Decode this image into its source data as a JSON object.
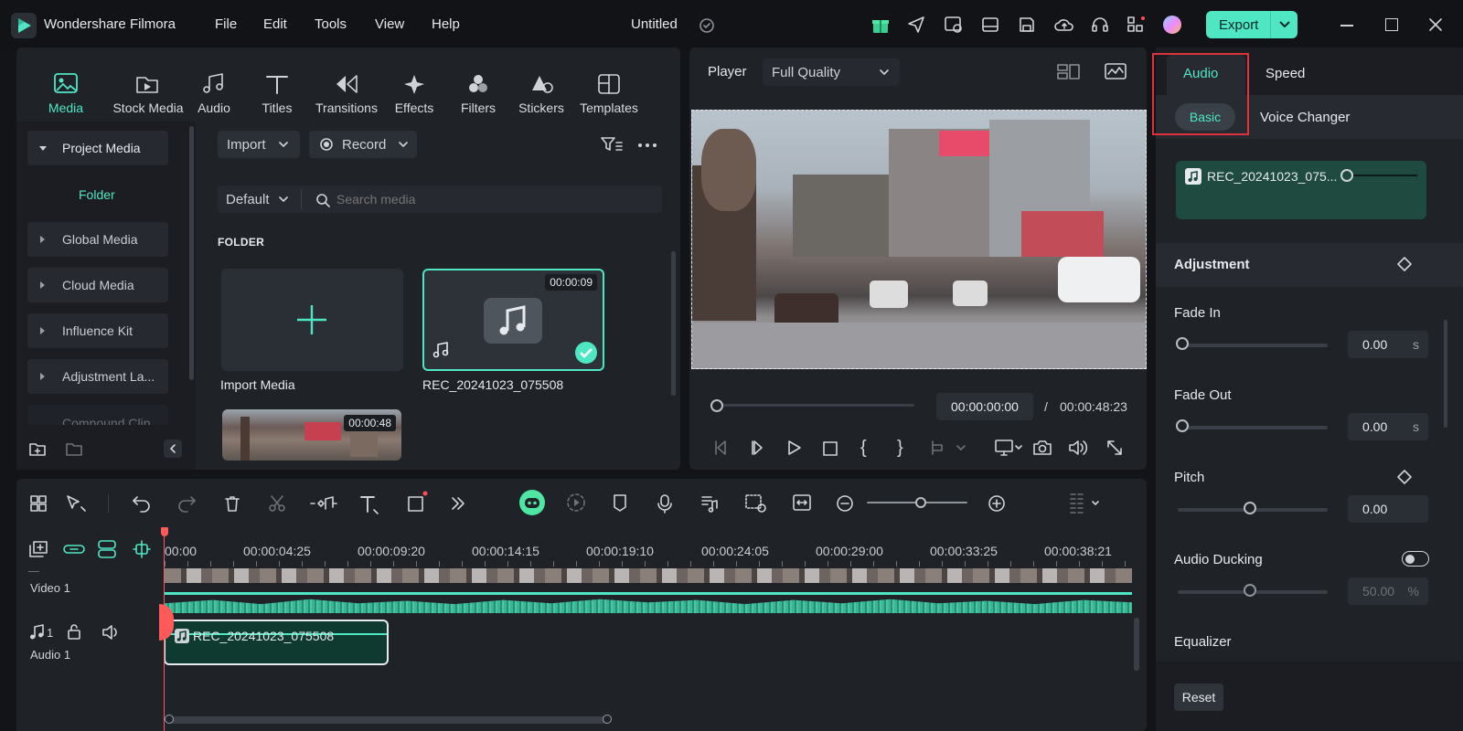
{
  "app": {
    "name": "Wondershare Filmora",
    "doc_title": "Untitled"
  },
  "menu": [
    "File",
    "Edit",
    "Tools",
    "View",
    "Help"
  ],
  "export_label": "Export",
  "library_tabs": [
    "Media",
    "Stock Media",
    "Audio",
    "Titles",
    "Transitions",
    "Effects",
    "Filters",
    "Stickers",
    "Templates"
  ],
  "sidebar": {
    "project_media": "Project Media",
    "folder": "Folder",
    "items": [
      "Global Media",
      "Cloud Media",
      "Influence Kit",
      "Adjustment La...",
      "Compound Clip"
    ]
  },
  "media": {
    "import_label": "Import",
    "record_label": "Record",
    "sort_label": "Default",
    "search_placeholder": "Search media",
    "folder_heading": "FOLDER",
    "import_media_label": "Import Media",
    "audio_clip": {
      "name": "REC_20241023_075508",
      "duration": "00:00:09"
    },
    "video_clip": {
      "duration": "00:00:48"
    }
  },
  "player": {
    "label": "Player",
    "quality": "Full Quality",
    "current_time": "00:00:00:00",
    "separator": "/",
    "total_time": "00:00:48:23",
    "progress": 0
  },
  "right_panel": {
    "tabs": [
      "Audio",
      "Speed"
    ],
    "subtabs": [
      "Basic",
      "Voice Changer"
    ],
    "clip_name": "REC_20241023_075...",
    "adjustment_heading": "Adjustment",
    "fade_in": {
      "label": "Fade In",
      "value": "0.00",
      "unit": "s"
    },
    "fade_out": {
      "label": "Fade Out",
      "value": "0.00",
      "unit": "s"
    },
    "pitch": {
      "label": "Pitch",
      "value": "0.00"
    },
    "audio_ducking": {
      "label": "Audio Ducking",
      "value": "50.00",
      "unit": "%"
    },
    "equalizer": "Equalizer",
    "reset": "Reset"
  },
  "timeline": {
    "ruler": [
      "00:00",
      "00:00:04:25",
      "00:00:09:20",
      "00:00:14:15",
      "00:00:19:10",
      "00:00:24:05",
      "00:00:29:00",
      "00:00:33:25",
      "00:00:38:21"
    ],
    "video_track": "Video 1",
    "audio_track": "Audio 1",
    "audio_track_num": "1",
    "audio_clip": "REC_20241023_075508"
  },
  "colors": {
    "accent": "#4fe6c4",
    "highlight_box": "#e0323a",
    "playhead": "#ff5a5a"
  }
}
